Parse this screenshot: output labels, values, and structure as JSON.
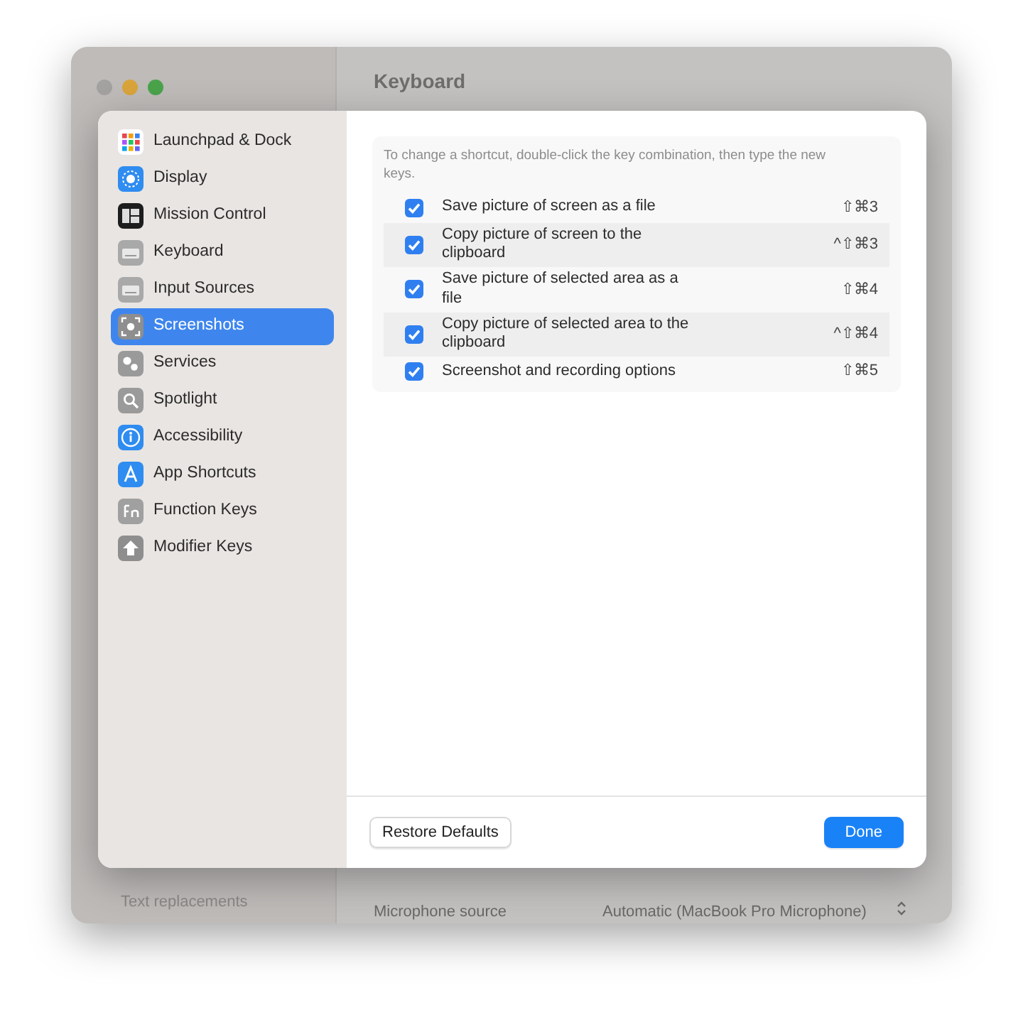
{
  "background_window": {
    "title": "Keyboard",
    "sidebar_items": [
      "Text replacements"
    ],
    "rows": [
      {
        "label": "Microphone source",
        "value": "Automatic (MacBook Pro Microphone)"
      }
    ]
  },
  "sheet": {
    "sidebar": {
      "items": [
        {
          "label": "Launchpad & Dock",
          "selected": false
        },
        {
          "label": "Display",
          "selected": false
        },
        {
          "label": "Mission Control",
          "selected": false
        },
        {
          "label": "Keyboard",
          "selected": false
        },
        {
          "label": "Input Sources",
          "selected": false
        },
        {
          "label": "Screenshots",
          "selected": true
        },
        {
          "label": "Services",
          "selected": false
        },
        {
          "label": "Spotlight",
          "selected": false
        },
        {
          "label": "Accessibility",
          "selected": false
        },
        {
          "label": "App Shortcuts",
          "selected": false
        },
        {
          "label": "Function Keys",
          "selected": false
        },
        {
          "label": "Modifier Keys",
          "selected": false
        }
      ]
    },
    "hint": "To change a shortcut, double-click the key combination, then type the new keys.",
    "shortcuts": [
      {
        "label": "Save picture of screen as a file",
        "shortcut": "⇧⌘3",
        "checked": true
      },
      {
        "label": "Copy picture of screen to the clipboard",
        "shortcut": "^⇧⌘3",
        "checked": true
      },
      {
        "label": "Save picture of selected area as a file",
        "shortcut": "⇧⌘4",
        "checked": true
      },
      {
        "label": "Copy picture of selected area to the clipboard",
        "shortcut": "^⇧⌘4",
        "checked": true
      },
      {
        "label": "Screenshot and recording options",
        "shortcut": "⇧⌘5",
        "checked": true
      }
    ],
    "buttons": [
      {
        "label": "Restore Defaults",
        "kind": "secondary"
      },
      {
        "label": "Done",
        "kind": "primary"
      }
    ]
  }
}
